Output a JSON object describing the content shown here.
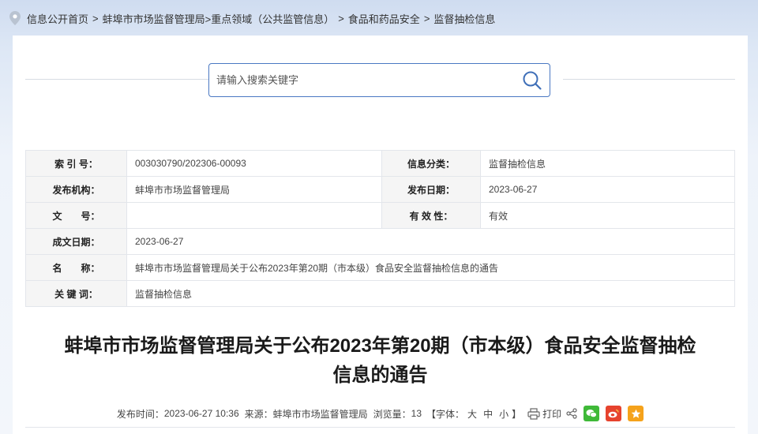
{
  "breadcrumb": {
    "items": [
      "信息公开首页",
      "蚌埠市市场监督管理局>重点领域（公共监管信息）",
      "食品和药品安全",
      "监督抽检信息"
    ],
    "separator": ">"
  },
  "search": {
    "placeholder": "请输入搜索关键字",
    "value": "",
    "icon": "search-icon"
  },
  "info": {
    "index_label": "索 引 号：",
    "index_value": "003030790/202306-00093",
    "category_label": "信息分类：",
    "category_value": "监督抽检信息",
    "publisher_label": "发布机构：",
    "publisher_value": "蚌埠市市场监督管理局",
    "pub_date_label": "发布日期：",
    "pub_date_value": "2023-06-27",
    "doc_no_label": "文　　号：",
    "doc_no_value": "",
    "validity_label": "有 效 性：",
    "validity_value": "有效",
    "created_label": "成文日期：",
    "created_value": "2023-06-27",
    "name_label": "名　　称：",
    "name_value": "蚌埠市市场监督管理局关于公布2023年第20期（市本级）食品安全监督抽检信息的通告",
    "keywords_label": "关 键 词：",
    "keywords_value": "监督抽检信息"
  },
  "article": {
    "title_line1": "蚌埠市市场监督管理局关于公布2023年第20期（市本级）食品安全监督抽检",
    "title_line2": "信息的通告"
  },
  "meta": {
    "time_label": "发布时间：",
    "time_value": "2023-06-27 10:36",
    "source_label": "来源：",
    "source_value": "蚌埠市市场监督管理局",
    "views_label": "浏览量：",
    "views_value": "13",
    "font_open": "【字体：",
    "font_large": "大",
    "font_medium": "中",
    "font_small": "小",
    "font_close": "】",
    "print_label": "打印"
  },
  "colors": {
    "accent": "#4a78c2",
    "wechat": "#3fb938",
    "weibo": "#e6432e",
    "favorite": "#f5a21b"
  }
}
